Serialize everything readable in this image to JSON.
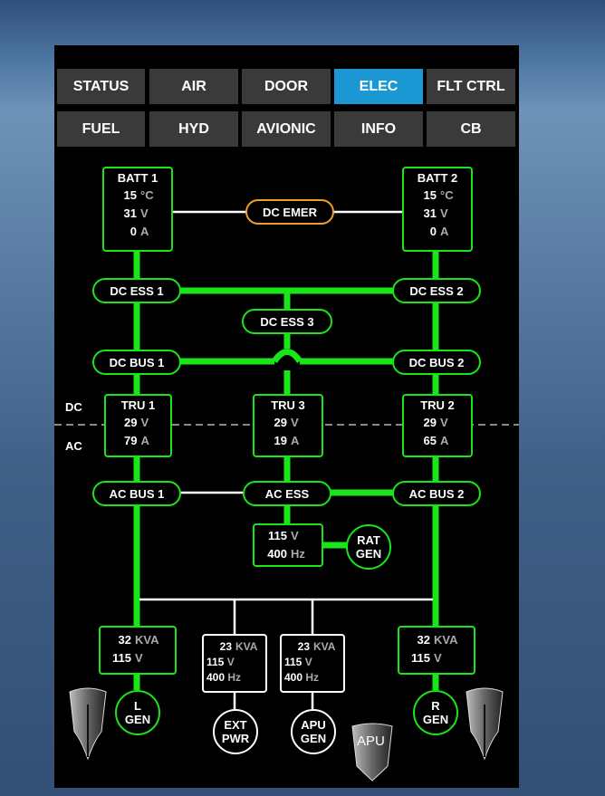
{
  "tabs_row1": [
    "STATUS",
    "AIR",
    "DOOR",
    "ELEC",
    "FLT CTRL"
  ],
  "tabs_row2": [
    "FUEL",
    "HYD",
    "AVIONIC",
    "INFO",
    "CB"
  ],
  "active_tab": "ELEC",
  "colors": {
    "active_tab": "#1b98d3",
    "bus_green": "#19e619",
    "amber": "#f0a020"
  },
  "batt1": {
    "title": "BATT 1",
    "temp": "15",
    "temp_unit": "°C",
    "volt": "31",
    "volt_unit": "V",
    "amp": "0",
    "amp_unit": "A"
  },
  "batt2": {
    "title": "BATT 2",
    "temp": "15",
    "temp_unit": "°C",
    "volt": "31",
    "volt_unit": "V",
    "amp": "0",
    "amp_unit": "A"
  },
  "dc_emer": "DC EMER",
  "dc_ess1": "DC ESS 1",
  "dc_ess2": "DC ESS 2",
  "dc_ess3": "DC ESS 3",
  "dc_bus1": "DC BUS 1",
  "dc_bus2": "DC BUS 2",
  "dc_label": "DC",
  "ac_label": "AC",
  "tru1": {
    "title": "TRU 1",
    "volt": "29",
    "volt_unit": "V",
    "amp": "79",
    "amp_unit": "A"
  },
  "tru3": {
    "title": "TRU 3",
    "volt": "29",
    "volt_unit": "V",
    "amp": "19",
    "amp_unit": "A"
  },
  "tru2": {
    "title": "TRU 2",
    "volt": "29",
    "volt_unit": "V",
    "amp": "65",
    "amp_unit": "A"
  },
  "ac_bus1": "AC BUS 1",
  "ac_ess": "AC ESS",
  "ac_bus2": "AC BUS 2",
  "rat_box": {
    "volt": "115",
    "volt_unit": "V",
    "freq": "400",
    "freq_unit": "Hz"
  },
  "rat_gen": [
    "RAT",
    "GEN"
  ],
  "gen_l": {
    "kva": "32",
    "kva_unit": "KVA",
    "volt": "115",
    "volt_unit": "V"
  },
  "gen_r": {
    "kva": "32",
    "kva_unit": "KVA",
    "volt": "115",
    "volt_unit": "V"
  },
  "ext_box": {
    "kva": "23",
    "kva_unit": "KVA",
    "volt": "115",
    "volt_unit": "V",
    "freq": "400",
    "freq_unit": "Hz"
  },
  "apu_box": {
    "kva": "23",
    "kva_unit": "KVA",
    "volt": "115",
    "volt_unit": "V",
    "freq": "400",
    "freq_unit": "Hz"
  },
  "l_gen": [
    "L",
    "GEN"
  ],
  "r_gen": [
    "R",
    "GEN"
  ],
  "ext_pwr": [
    "EXT",
    "PWR"
  ],
  "apu_gen": [
    "APU",
    "GEN"
  ],
  "apu_icon_label": "APU"
}
